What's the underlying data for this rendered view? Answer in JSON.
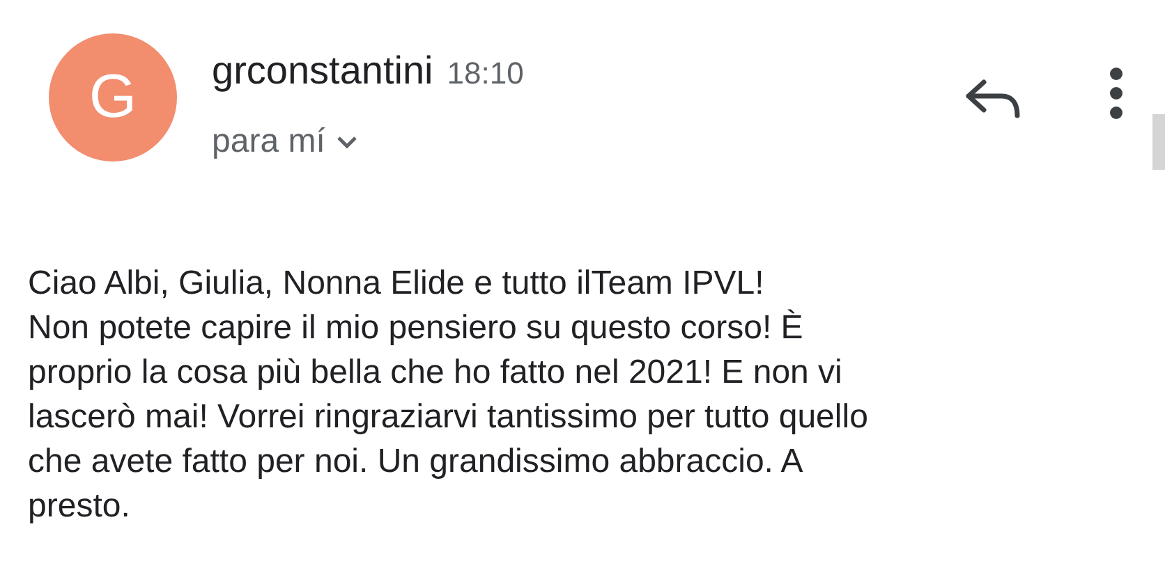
{
  "message": {
    "avatar_letter": "G",
    "sender": "grconstantini",
    "time": "18:10",
    "recipient": "para mí",
    "body_lines": [
      "Ciao Albi, Giulia, Nonna Elide e tutto ilTeam IPVL!",
      "Non potete capire il mio pensiero su questo corso! È",
      "proprio la cosa più bella che ho fatto nel 2021! E non vi",
      "lascerò mai! Vorrei ringraziarvi tantissimo per tutto quello",
      "che avete fatto per noi. Un grandissimo abbraccio. A",
      "presto."
    ]
  }
}
